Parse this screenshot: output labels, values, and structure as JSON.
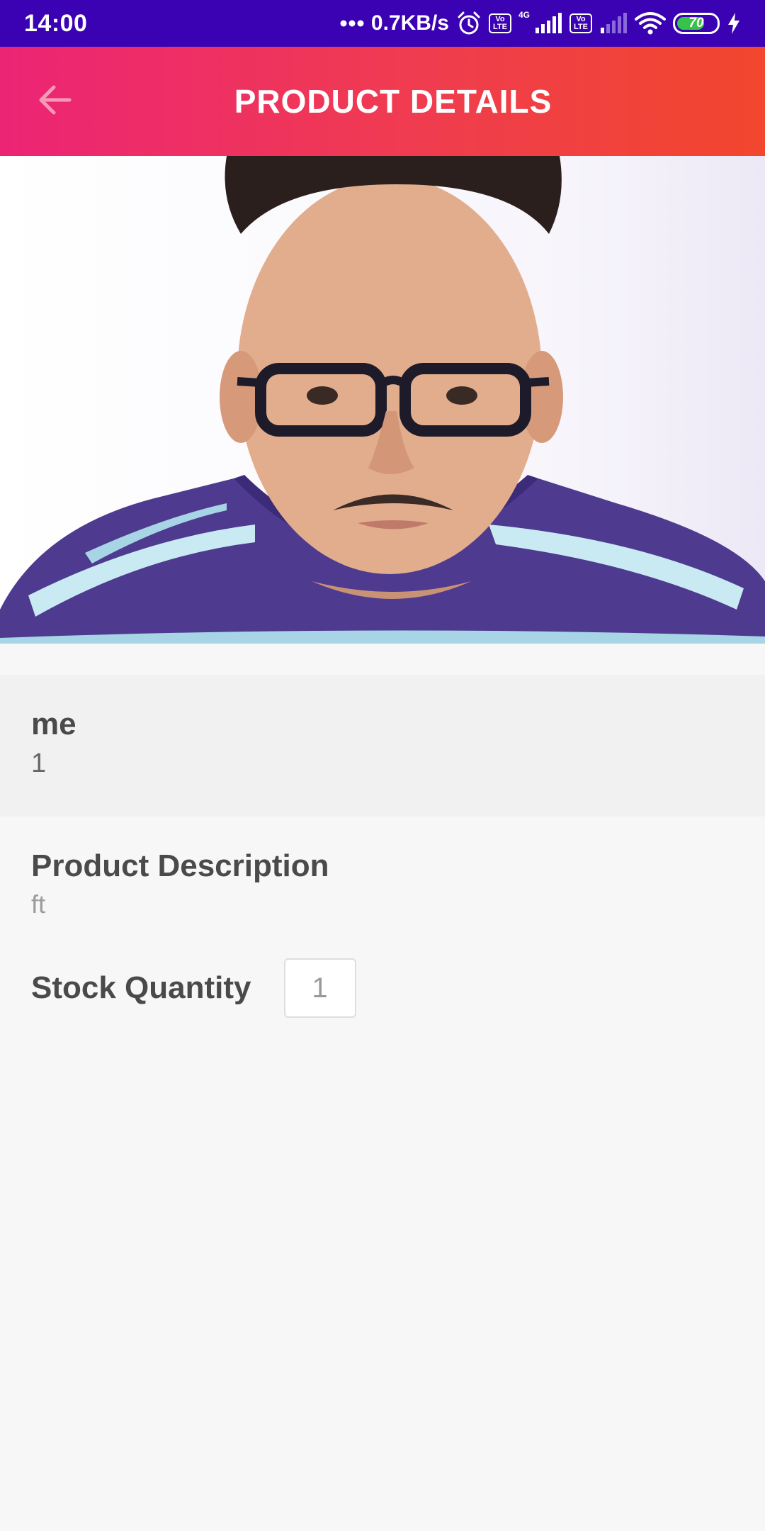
{
  "status_bar": {
    "time": "14:00",
    "speed": "0.7KB/s",
    "network_label": "4G",
    "volte_label_top": "Vo",
    "volte_label_bottom": "LTE",
    "battery_level": "70",
    "icons": [
      "dots-icon",
      "alarm-icon",
      "volte-icon",
      "signal-icon",
      "volte-icon",
      "signal-weak-icon",
      "wifi-icon",
      "battery-icon",
      "charging-icon"
    ]
  },
  "app_bar": {
    "title": "PRODUCT DETAILS",
    "back_icon": "arrow-left-icon"
  },
  "product": {
    "name_label": "me",
    "name_value": "1",
    "description_label": "Product Description",
    "description_value": "ft",
    "stock_label": "Stock Quantity",
    "stock_value": "1"
  },
  "colors": {
    "status_bar": "#3a02b3",
    "app_bar_start": "#ec2475",
    "app_bar_end": "#f2462d",
    "battery_fill": "#37c24a"
  }
}
